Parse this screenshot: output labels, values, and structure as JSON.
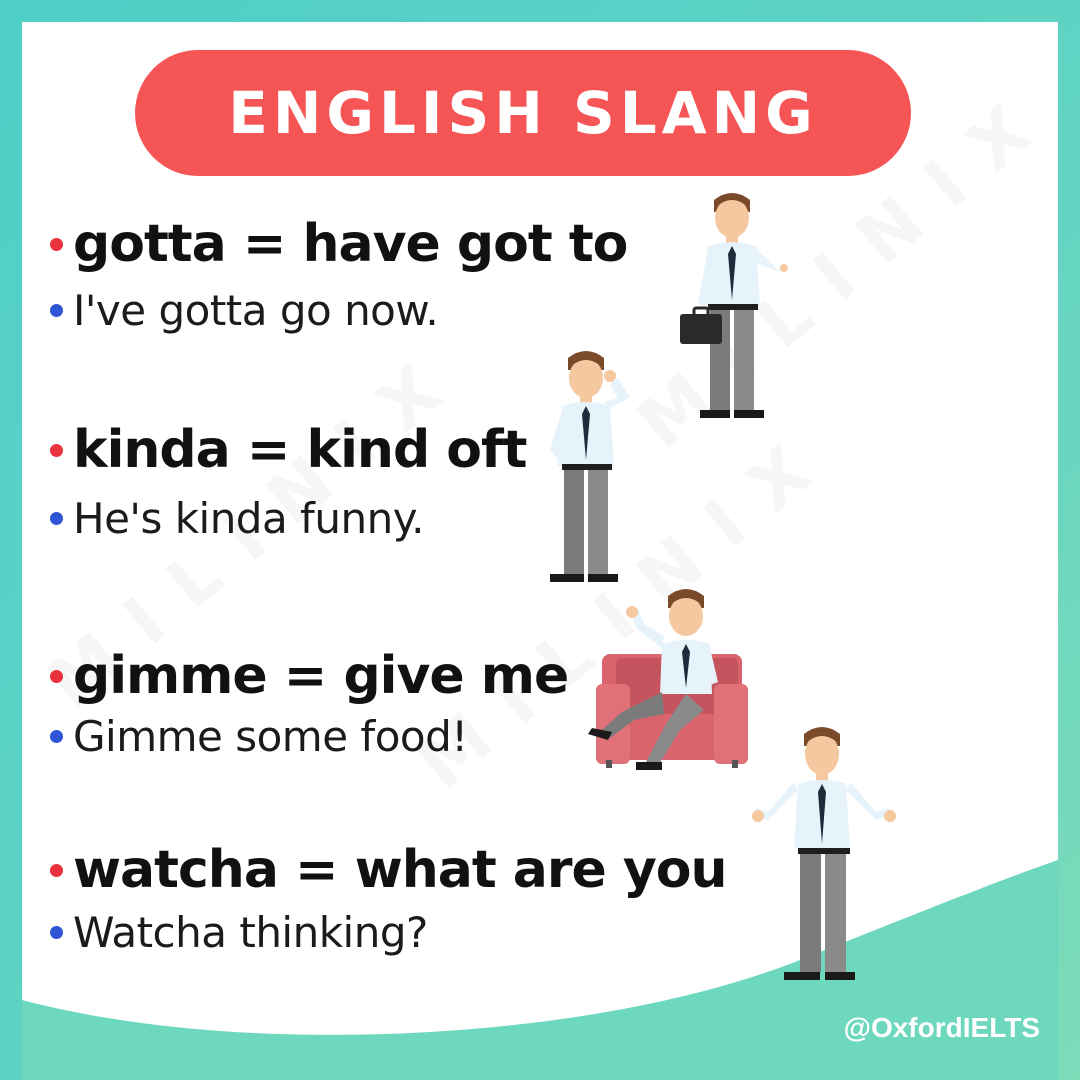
{
  "title": "ENGLISH SLANG",
  "watermark": "MILINIX",
  "handle": "@OxfordIELTS",
  "colors": {
    "title_bg": "#f65555",
    "term_bullet": "#e8333f",
    "example_bullet": "#2f55d4",
    "background": "#5ed3c4"
  },
  "items": [
    {
      "term": "gotta = have got to",
      "example": "I've gotta go now."
    },
    {
      "term": "kinda = kind oft",
      "example": "He's kinda funny."
    },
    {
      "term": "gimme = give me",
      "example": "Gimme some food!"
    },
    {
      "term": "watcha = what are you",
      "example": "Watcha thinking?"
    }
  ],
  "illustrations": [
    "businessman-with-briefcase-icon",
    "businessman-thinking-icon",
    "businessman-sitting-armchair-icon",
    "businessman-shrugging-icon"
  ]
}
